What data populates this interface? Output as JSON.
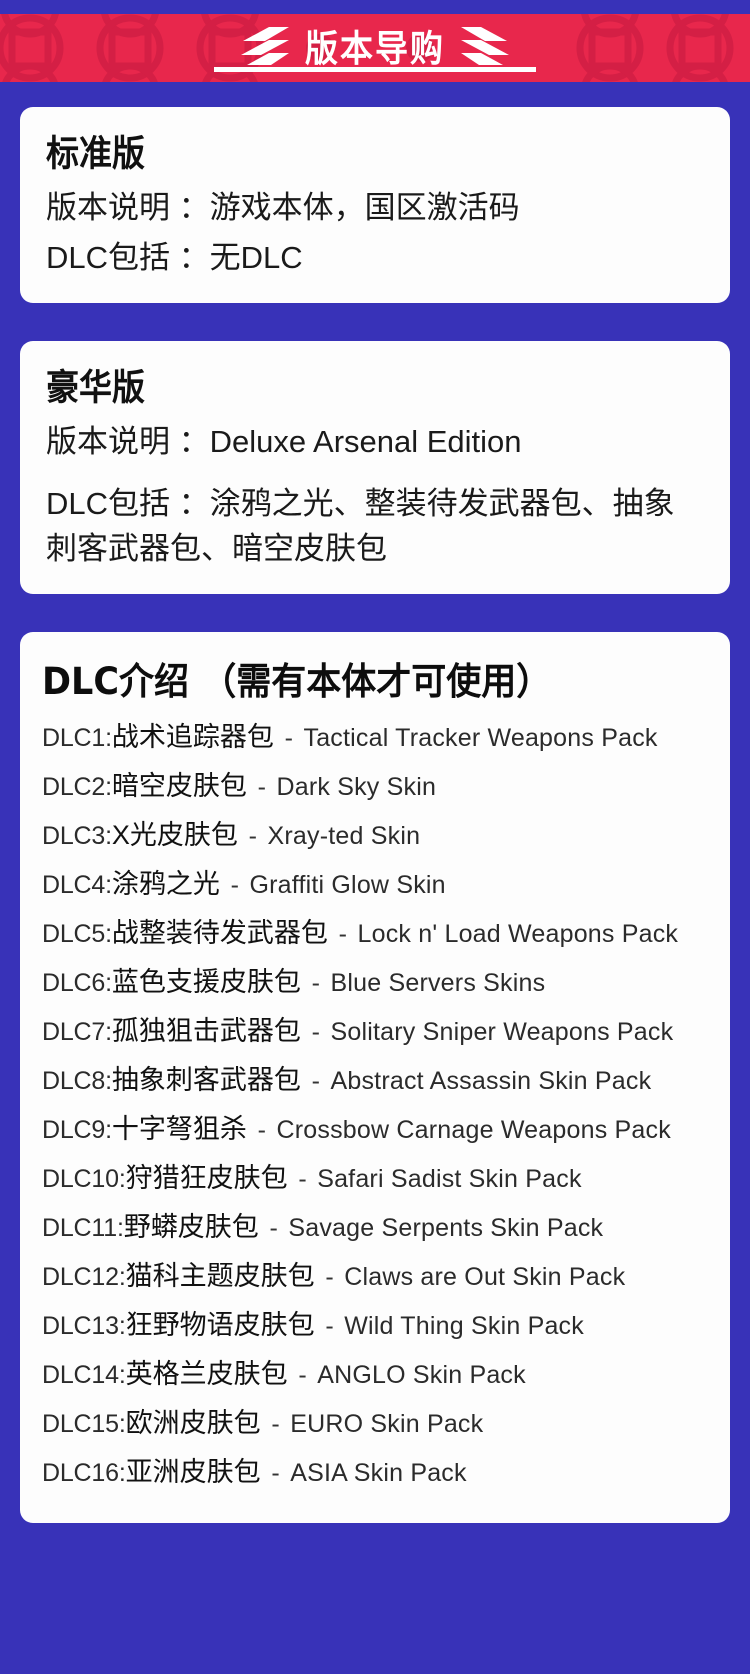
{
  "theme": {
    "background_color": "#3832b8",
    "banner_color": "#e8274c",
    "card_color": "#fdfdfd",
    "text_color": "#1a1a1a"
  },
  "banner": {
    "title": "版本导购",
    "left_icon": "slash-decoration-icon",
    "right_icon": "slash-decoration-icon"
  },
  "editions": [
    {
      "title": "标准版",
      "desc_label": "版本说明 ：",
      "desc_value": "游戏本体，国区激活码",
      "dlc_label": "DLC包括 ：",
      "dlc_value": "无DLC"
    },
    {
      "title": "豪华版",
      "desc_label": "版本说明 ：",
      "desc_value": "Deluxe Arsenal Edition",
      "dlc_label": "DLC包括 ：",
      "dlc_value": "涂鸦之光、整装待发武器包、抽象刺客武器包、暗空皮肤包"
    }
  ],
  "dlc_section": {
    "heading": "DLC介绍 （需有本体才可使用）",
    "items": [
      {
        "id": "DLC1:",
        "cn": "战术追踪器包",
        "sep": "-",
        "en": "Tactical Tracker Weapons Pack"
      },
      {
        "id": "DLC2:",
        "cn": "暗空皮肤包",
        "sep": "-",
        "en": "Dark Sky Skin"
      },
      {
        "id": "DLC3:",
        "cn": "X光皮肤包",
        "sep": "-",
        "en": "Xray-ted Skin"
      },
      {
        "id": "DLC4:",
        "cn": "涂鸦之光",
        "sep": "-",
        "en": "Graffiti Glow Skin"
      },
      {
        "id": "DLC5:",
        "cn": "战整装待发武器包",
        "sep": "-",
        "en": "Lock n' Load Weapons Pack"
      },
      {
        "id": "DLC6:",
        "cn": "蓝色支援皮肤包",
        "sep": "-",
        "en": "Blue Servers Skins"
      },
      {
        "id": "DLC7:",
        "cn": "孤独狙击武器包",
        "sep": "-",
        "en": "Solitary Sniper Weapons Pack"
      },
      {
        "id": "DLC8:",
        "cn": "抽象刺客武器包",
        "sep": "-",
        "en": "Abstract Assassin Skin Pack"
      },
      {
        "id": "DLC9:",
        "cn": "十字弩狙杀",
        "sep": "-",
        "en": "Crossbow Carnage Weapons Pack"
      },
      {
        "id": "DLC10:",
        "cn": "狩猎狂皮肤包",
        "sep": "-",
        "en": "Safari Sadist Skin Pack"
      },
      {
        "id": "DLC11:",
        "cn": "野蟒皮肤包",
        "sep": "-",
        "en": "Savage Serpents Skin Pack"
      },
      {
        "id": "DLC12:",
        "cn": "猫科主题皮肤包",
        "sep": "-",
        "en": "Claws are Out Skin Pack"
      },
      {
        "id": "DLC13:",
        "cn": "狂野物语皮肤包",
        "sep": "-",
        "en": "Wild Thing Skin Pack"
      },
      {
        "id": "DLC14:",
        "cn": "英格兰皮肤包",
        "sep": "-",
        "en": "ANGLO Skin Pack"
      },
      {
        "id": "DLC15:",
        "cn": "欧洲皮肤包",
        "sep": "-",
        "en": "EURO Skin Pack"
      },
      {
        "id": "DLC16:",
        "cn": "亚洲皮肤包",
        "sep": "-",
        "en": "ASIA Skin Pack"
      }
    ]
  }
}
